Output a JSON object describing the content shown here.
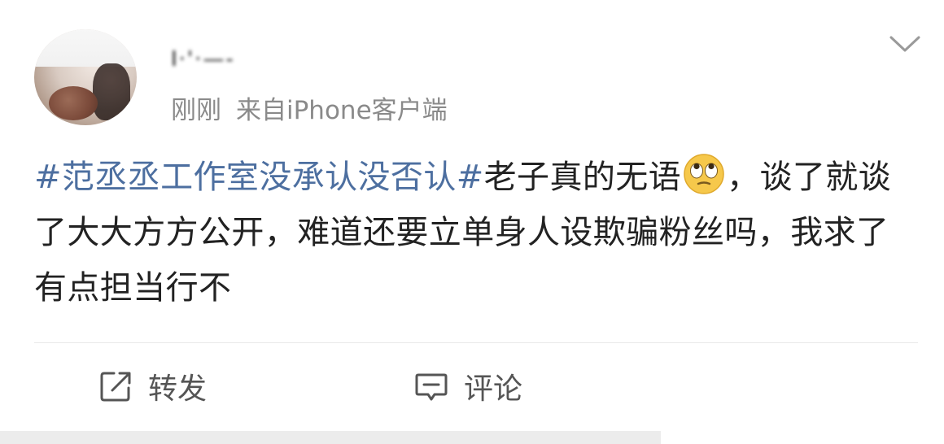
{
  "post": {
    "username": "I·'·—-",
    "meta": {
      "time": "刚刚",
      "source": "来自iPhone客户端"
    },
    "content": {
      "hashtag": "#范丞丞工作室没承认没否认#",
      "text_1": "老子真的无语",
      "emoji": "eye-roll-emoji",
      "text_2": "，谈了就谈了大大方方公开，难道还要立单身人设欺骗粉丝吗，我求了有点担当行不"
    },
    "actions": {
      "repost_label": "转发",
      "comment_label": "评论"
    }
  },
  "colors": {
    "hashtag": "#4d6fa0",
    "meta": "#8a8a8a",
    "text": "#222222"
  }
}
